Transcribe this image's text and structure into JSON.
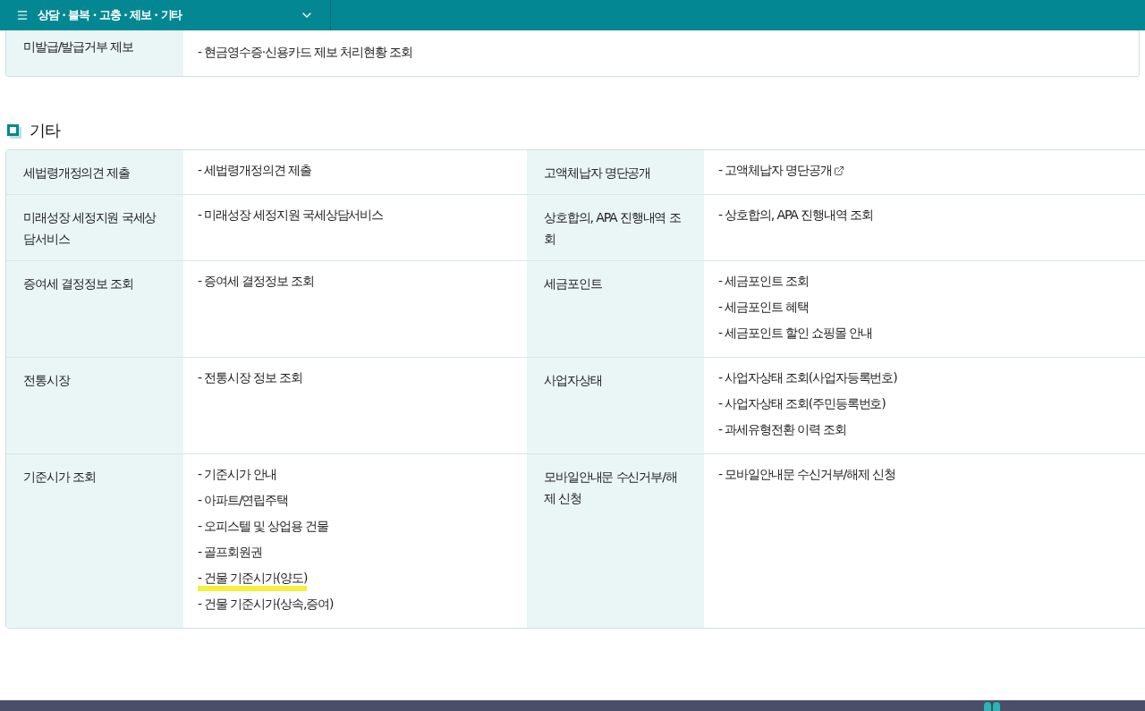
{
  "breadcrumb": {
    "title": "상담 · 불복 · 고충 · 제보 · 기타"
  },
  "top_fragment": {
    "label": "미발급/발급거부 제보",
    "items": [
      {
        "text": "- 현금영수증·신용카드 제보 처리현황 조회",
        "external": false,
        "highlighted": false
      }
    ]
  },
  "section_title": "기타",
  "rows": [
    {
      "groups": [
        {
          "label": "세법령개정의견 제출",
          "items": [
            {
              "text": "- 세법령개정의견 제출",
              "external": false,
              "highlighted": false
            }
          ]
        },
        {
          "label": "고액체납자 명단공개",
          "items": [
            {
              "text": "- 고액체납자 명단공개",
              "external": true,
              "highlighted": false
            }
          ]
        }
      ]
    },
    {
      "groups": [
        {
          "label": "미래성장 세정지원 국세상담서비스",
          "items": [
            {
              "text": "- 미래성장 세정지원 국세상담서비스",
              "external": false,
              "highlighted": false
            }
          ]
        },
        {
          "label": "상호합의, APA 진행내역 조회",
          "items": [
            {
              "text": "- 상호합의, APA 진행내역 조회",
              "external": false,
              "highlighted": false
            }
          ]
        }
      ]
    },
    {
      "groups": [
        {
          "label": "증여세 결정정보 조회",
          "items": [
            {
              "text": "- 증여세 결정정보 조회",
              "external": false,
              "highlighted": false
            }
          ]
        },
        {
          "label": "세금포인트",
          "items": [
            {
              "text": "- 세금포인트 조회",
              "external": false,
              "highlighted": false
            },
            {
              "text": "- 세금포인트 혜택",
              "external": false,
              "highlighted": false
            },
            {
              "text": "- 세금포인트 할인 쇼핑몰 안내",
              "external": false,
              "highlighted": false
            }
          ]
        }
      ]
    },
    {
      "groups": [
        {
          "label": "전통시장",
          "items": [
            {
              "text": "- 전통시장 정보 조회",
              "external": false,
              "highlighted": false
            }
          ]
        },
        {
          "label": "사업자상태",
          "items": [
            {
              "text": "- 사업자상태 조회(사업자등록번호)",
              "external": false,
              "highlighted": false
            },
            {
              "text": "- 사업자상태 조회(주민등록번호)",
              "external": false,
              "highlighted": false
            },
            {
              "text": "- 과세유형전환 이력 조회",
              "external": false,
              "highlighted": false
            }
          ]
        }
      ]
    },
    {
      "groups": [
        {
          "label": "기준시가 조회",
          "items": [
            {
              "text": "- 기준시가 안내",
              "external": false,
              "highlighted": false
            },
            {
              "text": "- 아파트/연립주택",
              "external": false,
              "highlighted": false
            },
            {
              "text": "- 오피스텔 및 상업용 건물",
              "external": false,
              "highlighted": false
            },
            {
              "text": "- 골프회원권",
              "external": false,
              "highlighted": false
            },
            {
              "text": "- 건물 기준시가(양도)",
              "external": false,
              "highlighted": true
            },
            {
              "text": "- 건물 기준시가(상속,증여)",
              "external": false,
              "highlighted": false
            }
          ]
        },
        {
          "label": "모바일안내문 수신거부/해제 신청",
          "items": [
            {
              "text": "- 모바일안내문 수신거부/해제 신청",
              "external": false,
              "highlighted": false
            }
          ]
        }
      ]
    }
  ]
}
